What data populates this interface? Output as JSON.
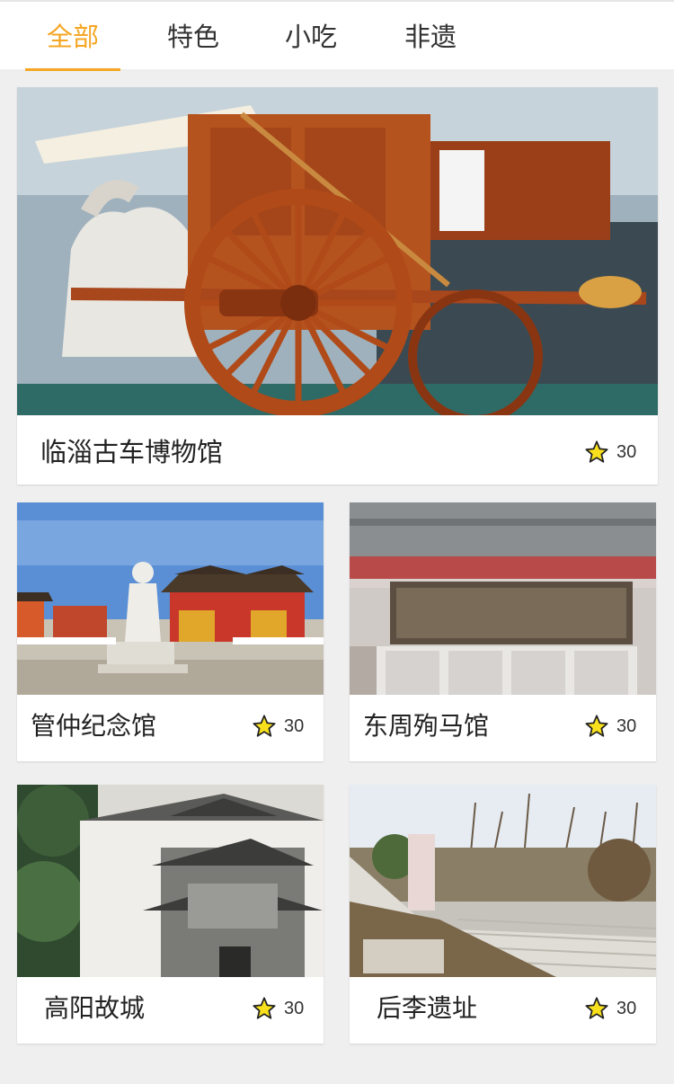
{
  "tabs": [
    {
      "label": "全部"
    },
    {
      "label": "特色"
    },
    {
      "label": "小吃"
    },
    {
      "label": "非遗"
    }
  ],
  "accent_color": "#f5a623",
  "rating_icon": "star-icon",
  "places": [
    {
      "name": "临淄古车博物馆",
      "rating": "30",
      "image": "ancient-chariot-photo"
    },
    {
      "name": "管仲纪念馆",
      "rating": "30",
      "image": "statue-temple-photo"
    },
    {
      "name": "东周殉马馆",
      "rating": "30",
      "image": "museum-plaque-photo"
    },
    {
      "name": "高阳故城",
      "rating": "30",
      "image": "old-gate-wall-photo"
    },
    {
      "name": "后李遗址",
      "rating": "30",
      "image": "stone-stairs-monument-photo"
    }
  ]
}
